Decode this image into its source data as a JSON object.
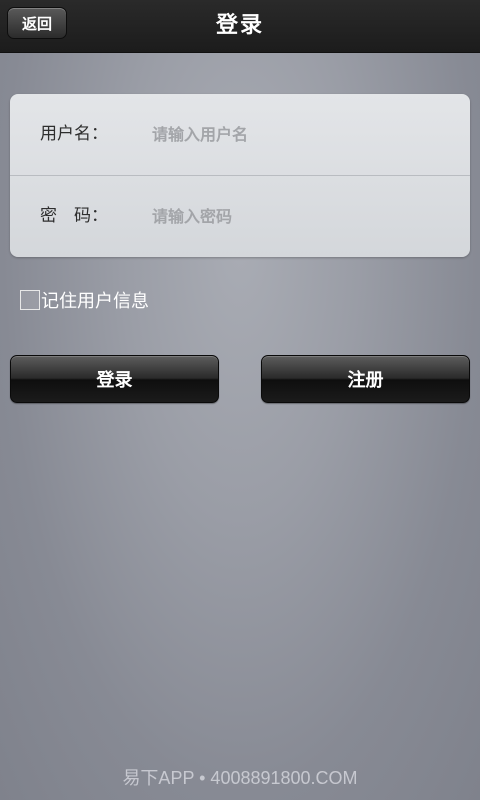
{
  "header": {
    "back_label": "返回",
    "title": "登录"
  },
  "form": {
    "username": {
      "label": "用户名：",
      "placeholder": "请输入用户名",
      "value": ""
    },
    "password": {
      "label": "密　码：",
      "placeholder": "请输入密码",
      "value": ""
    }
  },
  "remember": {
    "label": "记住用户信息",
    "checked": false
  },
  "actions": {
    "login_label": "登录",
    "register_label": "注册"
  },
  "watermark": "易下APP • 4008891800.COM",
  "colors": {
    "titlebar": "#1c1c1c",
    "background": "#9a9da6",
    "card": "#dcdfe2",
    "button": "#1b1b1b"
  }
}
